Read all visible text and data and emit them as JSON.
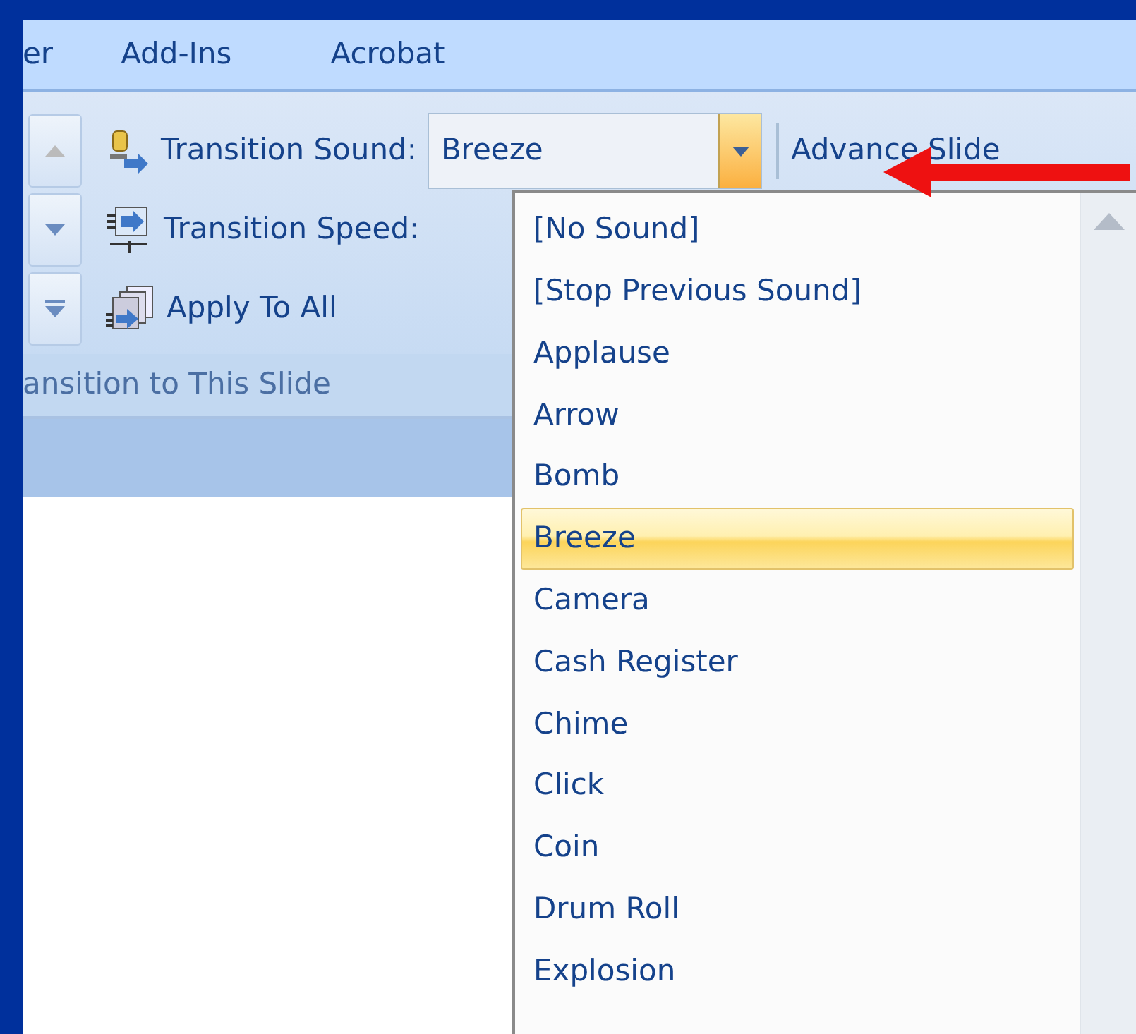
{
  "tabs": [
    "er",
    "Add-Ins",
    "Acrobat"
  ],
  "ribbon": {
    "commands": [
      {
        "kind": "combo",
        "label": "Transition Sound:",
        "value": "Breeze",
        "open": true
      },
      {
        "kind": "combo",
        "label": "Transition Speed:"
      },
      {
        "kind": "button",
        "label": "Apply To All"
      }
    ],
    "group_label": "ansition to This Slide",
    "next_label": "Advance Slide"
  },
  "dropdown": {
    "items": [
      {
        "label": "[No Sound]",
        "selected": false
      },
      {
        "label": "[Stop Previous Sound]",
        "selected": false
      },
      {
        "label": "Applause",
        "selected": false
      },
      {
        "label": "Arrow",
        "selected": false
      },
      {
        "label": "Bomb",
        "selected": false
      },
      {
        "label": "Breeze",
        "selected": true
      },
      {
        "label": "Camera",
        "selected": false
      },
      {
        "label": "Cash Register",
        "selected": false
      },
      {
        "label": "Chime",
        "selected": false
      },
      {
        "label": "Click",
        "selected": false
      },
      {
        "label": "Coin",
        "selected": false
      },
      {
        "label": "Drum Roll",
        "selected": false
      },
      {
        "label": "Explosion",
        "selected": false
      }
    ]
  }
}
